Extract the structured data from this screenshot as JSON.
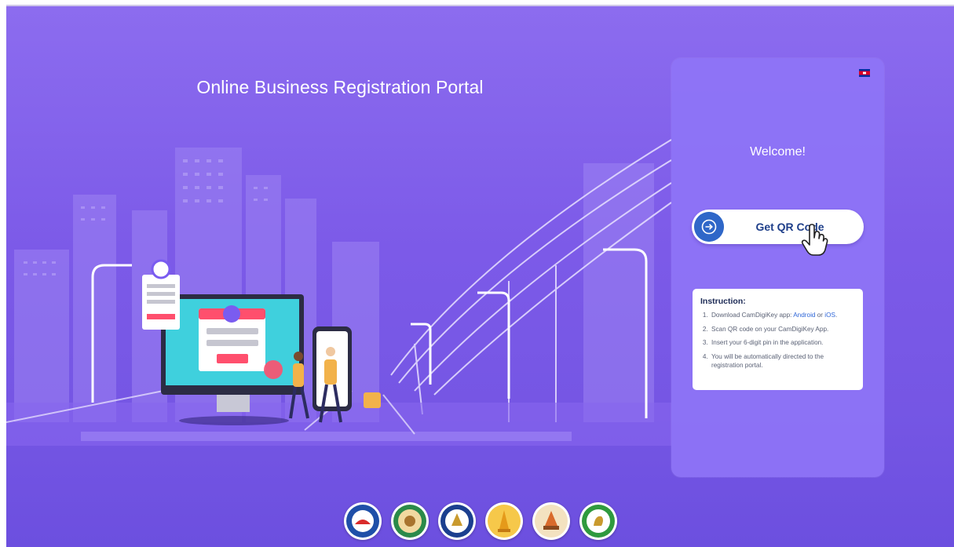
{
  "portal": {
    "title": "Online Business Registration Portal"
  },
  "login": {
    "language_flag": "cambodia-flag-icon",
    "welcome": "Welcome!",
    "qr_button_label": "Get QR Code"
  },
  "instructions": {
    "heading": "Instruction:",
    "step1_prefix": "Download CamDigiKey app: ",
    "android_label": "Android",
    "or_label": " or ",
    "ios_label": "iOS",
    "step1_suffix": ".",
    "step2": "Scan QR code on your CamDigiKey App.",
    "step3": "Insert your 6-digit pin in the application.",
    "step4": "You will be automatically directed to the registration portal."
  },
  "colors": {
    "background": "#7c5ae8",
    "card": "#8e74f6",
    "button_icon": "#2f67c8",
    "link": "#2f67d8"
  },
  "ministry_logos": [
    "ministry-logo-1",
    "ministry-logo-2",
    "ministry-logo-3",
    "ministry-logo-4",
    "ministry-logo-5",
    "ministry-logo-6"
  ]
}
